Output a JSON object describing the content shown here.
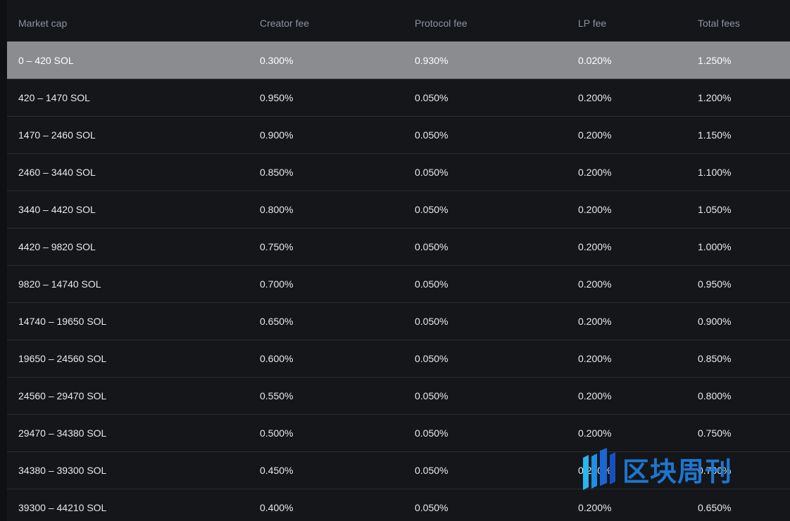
{
  "table": {
    "headers": [
      "Market cap",
      "Creator fee",
      "Protocol fee",
      "LP fee",
      "Total fees"
    ],
    "rows": [
      [
        "0 – 420 SOL",
        "0.300%",
        "0.930%",
        "0.020%",
        "1.250%"
      ],
      [
        "420 – 1470 SOL",
        "0.950%",
        "0.050%",
        "0.200%",
        "1.200%"
      ],
      [
        "1470 – 2460 SOL",
        "0.900%",
        "0.050%",
        "0.200%",
        "1.150%"
      ],
      [
        "2460 – 3440 SOL",
        "0.850%",
        "0.050%",
        "0.200%",
        "1.100%"
      ],
      [
        "3440 – 4420 SOL",
        "0.800%",
        "0.050%",
        "0.200%",
        "1.050%"
      ],
      [
        "4420 – 9820 SOL",
        "0.750%",
        "0.050%",
        "0.200%",
        "1.000%"
      ],
      [
        "9820 – 14740 SOL",
        "0.700%",
        "0.050%",
        "0.200%",
        "0.950%"
      ],
      [
        "14740 – 19650 SOL",
        "0.650%",
        "0.050%",
        "0.200%",
        "0.900%"
      ],
      [
        "19650 – 24560 SOL",
        "0.600%",
        "0.050%",
        "0.200%",
        "0.850%"
      ],
      [
        "24560 – 29470 SOL",
        "0.550%",
        "0.050%",
        "0.200%",
        "0.800%"
      ],
      [
        "29470 – 34380 SOL",
        "0.500%",
        "0.050%",
        "0.200%",
        "0.750%"
      ],
      [
        "34380 – 39300 SOL",
        "0.450%",
        "0.050%",
        "0.200%",
        "0.700%"
      ],
      [
        "39300 – 44210 SOL",
        "0.400%",
        "0.050%",
        "0.200%",
        "0.650%"
      ]
    ]
  },
  "watermark": {
    "text": "区块周刊"
  },
  "colors": {
    "background": "#151619",
    "header_text": "#8b93a1",
    "row_text": "#e8e9eb",
    "selected_row": "#8a8c90",
    "row_divider": "#2a2c31",
    "watermark": "#1e7fe0"
  }
}
